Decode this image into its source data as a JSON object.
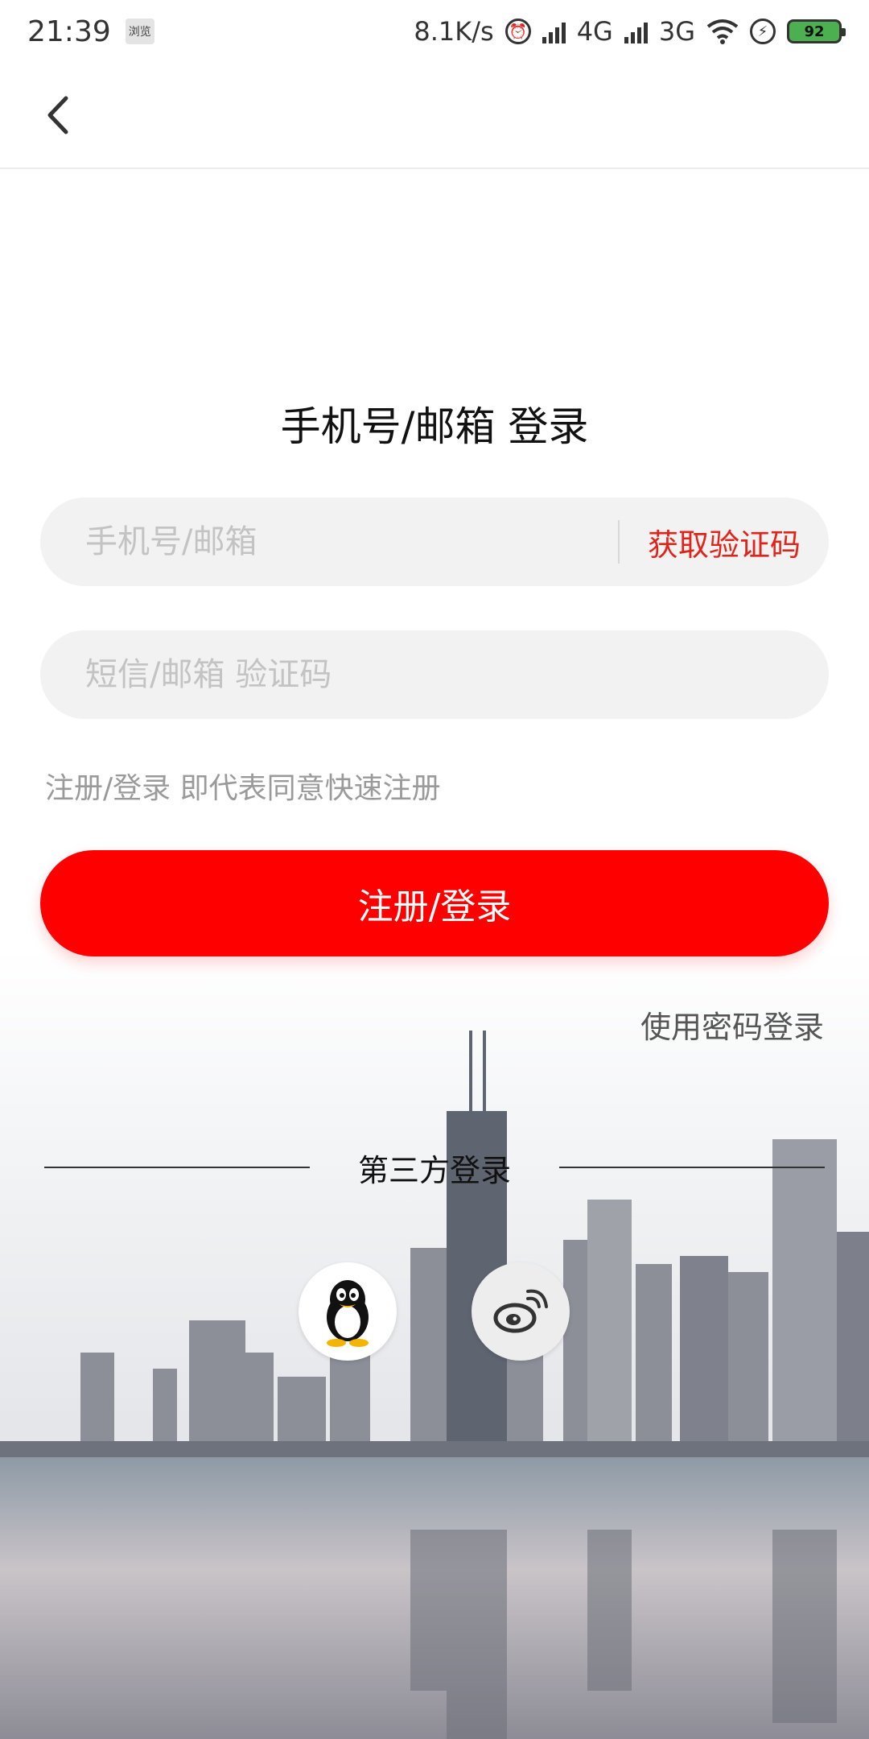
{
  "status_bar": {
    "time": "21:39",
    "app_icon_text": "浏览",
    "net_speed": "8.1K/s",
    "network_1": "4G",
    "network_2": "3G",
    "battery": "92",
    "icons": [
      "alarm-icon",
      "signal-icon",
      "wifi-icon",
      "charging-icon",
      "battery-icon"
    ]
  },
  "nav": {
    "back_icon": "chevron-left-icon"
  },
  "login": {
    "title": "手机号/邮箱 登录",
    "account_placeholder": "手机号/邮箱",
    "get_code_label": "获取验证码",
    "code_placeholder": "短信/邮箱 验证码",
    "agreement_text": "注册/登录 即代表同意快速注册",
    "submit_label": "注册/登录",
    "password_login_label": "使用密码登录"
  },
  "third_party": {
    "label": "第三方登录",
    "providers": [
      {
        "icon": "qq-penguin-icon"
      },
      {
        "icon": "weibo-icon"
      }
    ]
  },
  "colors": {
    "accent": "#FF0000",
    "link_red": "#E2231A",
    "field_bg": "#F2F2F2",
    "placeholder": "#C3C3C3"
  }
}
